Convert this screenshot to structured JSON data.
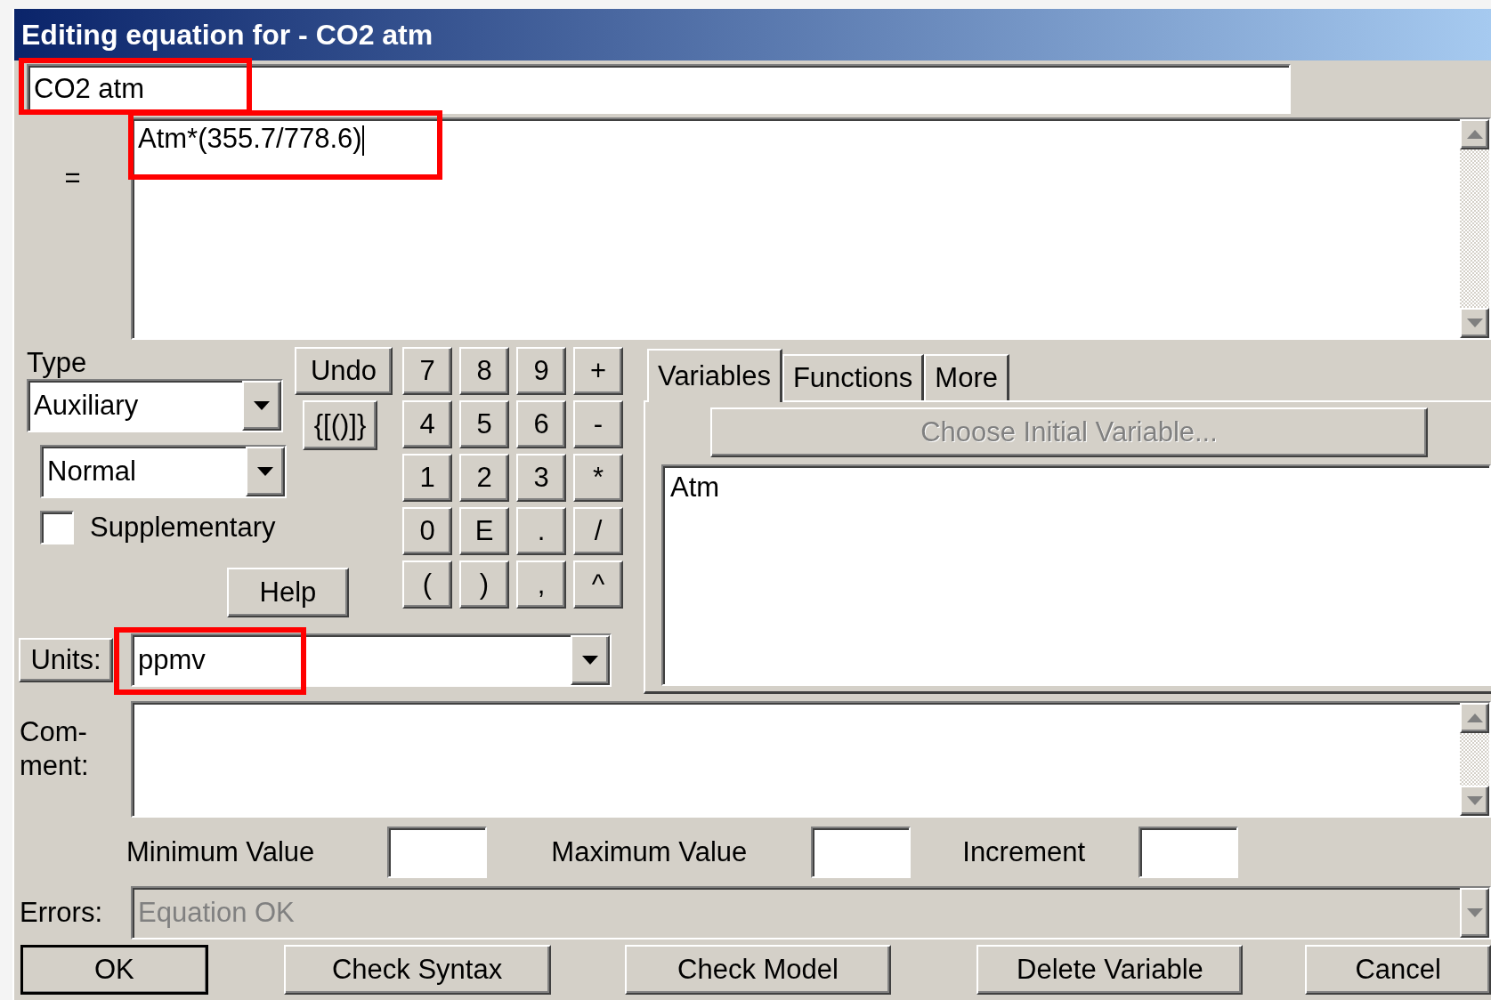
{
  "window": {
    "title": "Editing equation for - CO2 atm"
  },
  "name_field": {
    "value": "CO2 atm",
    "highlighted": true
  },
  "equation": {
    "label": "=",
    "value": "Atm*(355.7/778.6)",
    "highlighted": true
  },
  "type": {
    "label": "Type",
    "combos": [
      {
        "value": "Auxiliary"
      },
      {
        "value": "Normal"
      }
    ],
    "supplementary": {
      "label": "Supplementary",
      "checked": false
    }
  },
  "edit_buttons": {
    "undo": "Undo",
    "brackets": "{[()]}",
    "help": "Help"
  },
  "keypad": [
    "7",
    "8",
    "9",
    "+",
    "4",
    "5",
    "6",
    "-",
    "1",
    "2",
    "3",
    "*",
    "0",
    "E",
    ".",
    "/",
    "(",
    ")",
    ",",
    "^"
  ],
  "units": {
    "label": "Units:",
    "value": "ppmv",
    "highlighted": true
  },
  "tabs": [
    {
      "label": "Variables",
      "selected": true
    },
    {
      "label": "Functions",
      "selected": false
    },
    {
      "label": "More",
      "selected": false
    }
  ],
  "choose_button": {
    "label": "Choose Initial Variable...",
    "disabled": true
  },
  "variables": [
    "Atm"
  ],
  "comment": {
    "label": "Com-\nment:"
  },
  "range": [
    {
      "label": "Minimum Value"
    },
    {
      "label": "Maximum Value"
    },
    {
      "label": "Increment"
    }
  ],
  "errors": {
    "label": "Errors:",
    "value": "Equation OK",
    "disabled": true
  },
  "actions": [
    {
      "label": "OK",
      "default": true
    },
    {
      "label": "Check Syntax",
      "default": false
    },
    {
      "label": "Check Model",
      "default": false
    },
    {
      "label": "Delete Variable",
      "default": false
    },
    {
      "label": "Cancel",
      "default": false
    }
  ]
}
